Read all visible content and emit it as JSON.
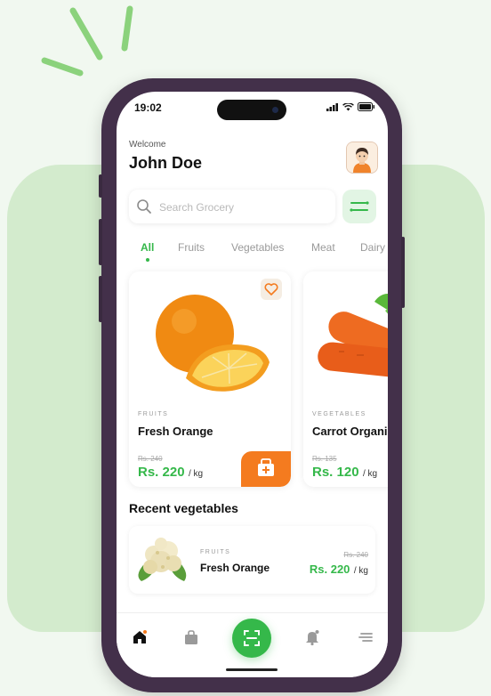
{
  "status_bar": {
    "time": "19:02"
  },
  "header": {
    "welcome": "Welcome",
    "username": "John Doe"
  },
  "search": {
    "placeholder": "Search Grocery"
  },
  "tabs": [
    {
      "label": "All",
      "active": true
    },
    {
      "label": "Fruits",
      "active": false
    },
    {
      "label": "Vegetables",
      "active": false
    },
    {
      "label": "Meat",
      "active": false
    },
    {
      "label": "Dairy",
      "active": false
    }
  ],
  "products": [
    {
      "category": "FRUITS",
      "name": "Fresh Orange",
      "old_price": "Rs. 240",
      "price": "Rs. 220",
      "unit": "/ kg"
    },
    {
      "category": "VEGETABLES",
      "name": "Carrot Organic",
      "old_price": "Rs. 135",
      "price": "Rs. 120",
      "unit": "/ kg"
    }
  ],
  "recent": {
    "title": "Recent vegetables",
    "items": [
      {
        "category": "FRUITS",
        "name": "Fresh Orange",
        "old_price": "Rs. 240",
        "price": "Rs. 220",
        "unit": "/ kg"
      }
    ]
  },
  "icons": {
    "search": "search-icon",
    "filter": "filter-icon",
    "heart": "heart-icon",
    "cart": "bag-plus-icon",
    "home": "home-icon",
    "orders": "bag-icon",
    "scan": "scan-icon",
    "notifications": "bell-icon",
    "menu": "menu-icon"
  },
  "colors": {
    "accent_green": "#35b84a",
    "accent_orange": "#f47b1f",
    "phone_frame": "#43304a",
    "background": "#f1f8f0"
  }
}
